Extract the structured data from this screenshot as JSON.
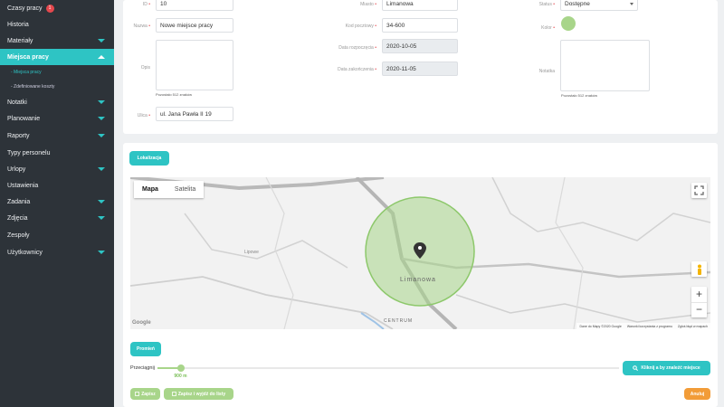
{
  "sidebar": {
    "items": [
      {
        "label": "Czasy pracy",
        "badge": "1"
      },
      {
        "label": "Historia"
      },
      {
        "label": "Materiały"
      },
      {
        "label": "Miejsca pracy"
      },
      {
        "label": "Notatki"
      },
      {
        "label": "Planowanie"
      },
      {
        "label": "Raporty"
      },
      {
        "label": "Typy personelu"
      },
      {
        "label": "Urlopy"
      },
      {
        "label": "Ustawienia"
      },
      {
        "label": "Zadania"
      },
      {
        "label": "Zdjęcia"
      },
      {
        "label": "Zespoły"
      },
      {
        "label": "Użytkownicy"
      }
    ],
    "subitems": [
      {
        "label": "- Miejsca pracy"
      },
      {
        "label": "- Zdefiniowane koszty"
      }
    ]
  },
  "form": {
    "id_label": "ID",
    "id_value": "10",
    "name_label": "Nazwa",
    "name_value": "Nowe miejsce pracy",
    "desc_label": "Opis",
    "desc_hint": "Pozostało 512 znaków",
    "street_label": "Ulica",
    "street_value": "ul. Jana Pawła II 19",
    "city_label": "Miasto",
    "city_value": "Limanowa",
    "zip_label": "Kod pocztowy",
    "zip_value": "34-600",
    "start_label": "Data rozpoczęcia",
    "start_value": "2020-10-05",
    "end_label": "Data zakończenia",
    "end_value": "2020-11-05",
    "status_label": "Status",
    "status_value": "Dostępne",
    "color_label": "Kolor",
    "color_value": "#a8d58a",
    "notes_label": "Notatka",
    "notes_hint": "Pozostało 512 znaków"
  },
  "location": {
    "button": "Lokalizacja",
    "tab_map": "Mapa",
    "tab_satellite": "Satelita",
    "towns": {
      "lipowe": "Lipowe",
      "limanowa": "Limanowa",
      "centrum": "CENTRUM"
    },
    "attribution": [
      "Dane do Mapy ©2020 Google",
      "Warunki korzystania z programu",
      "Zgłoś błąd w mapach"
    ],
    "google": "Google",
    "zoom_in": "+",
    "zoom_out": "−"
  },
  "radius": {
    "button": "Promień",
    "drag_label": "Przeciągnij",
    "value": "900 m",
    "fraction": 0.05,
    "find_button": "Kliknij a by znaleźć miejsce"
  },
  "actions": {
    "save": "Zapisz",
    "save_back": "Zapisz i wyjdź do listy",
    "cancel": "Anuluj"
  },
  "colors": {
    "accent": "#2ec4c4",
    "green": "#a8d58a",
    "orange": "#f29c38",
    "sidebar": "#2d3339"
  }
}
